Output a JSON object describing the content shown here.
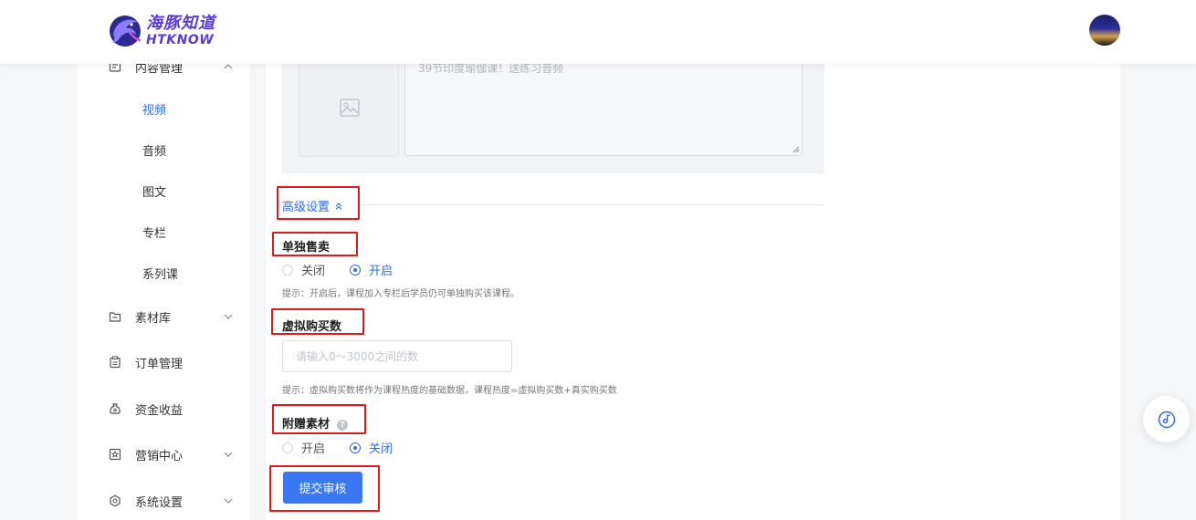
{
  "brand": {
    "name_cn": "海豚知道",
    "name_en": "HTKNOW",
    "color": "#5b3bd6"
  },
  "accent_color": "#2f6be8",
  "sidebar": {
    "content_group": {
      "label": "内容管理",
      "icon": "content-icon"
    },
    "sub_items": [
      {
        "label": "视频",
        "active": true
      },
      {
        "label": "音频"
      },
      {
        "label": "图文"
      },
      {
        "label": "专栏"
      },
      {
        "label": "系列课"
      }
    ],
    "groups": [
      {
        "label": "素材库",
        "icon": "folder-icon",
        "expandable": true
      },
      {
        "label": "订单管理",
        "icon": "clipboard-icon",
        "expandable": false
      },
      {
        "label": "资金收益",
        "icon": "money-bag-icon",
        "expandable": false
      },
      {
        "label": "营销中心",
        "icon": "star-badge-icon",
        "expandable": true
      },
      {
        "label": "系统设置",
        "icon": "settings-icon",
        "expandable": true
      }
    ]
  },
  "form": {
    "description_value": "39节印度瑜伽课！送练习音频",
    "advanced_label": "高级设置",
    "sell_separately": {
      "title": "单独售卖",
      "options": [
        "关闭",
        "开启"
      ],
      "selected": "开启",
      "hint": "提示：开启后，课程加入专栏后学员仍可单独购买该课程。"
    },
    "virtual_purchases": {
      "title": "虚拟购买数",
      "placeholder": "请输入0～3000之间的数",
      "hint": "提示：虚拟购买数将作为课程热度的基础数据，课程热度=虚拟购买数+真实购买数"
    },
    "bonus_materials": {
      "title": "附赠素材",
      "help": "?",
      "options": [
        "开启",
        "关闭"
      ],
      "selected": "关闭"
    },
    "submit_label": "提交审核"
  }
}
